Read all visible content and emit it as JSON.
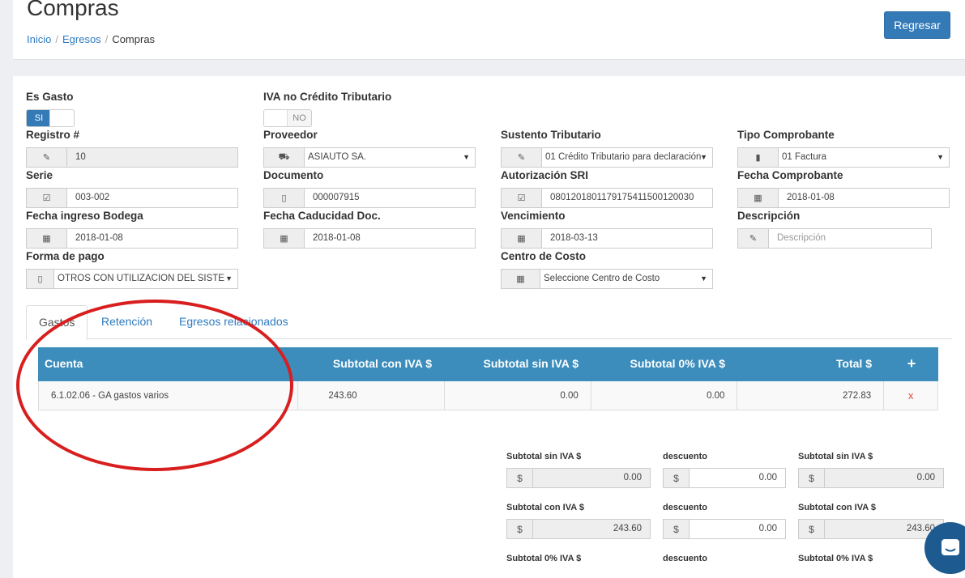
{
  "header": {
    "title": "Compras",
    "breadcrumb": [
      "Inicio",
      "Egresos",
      "Compras"
    ],
    "back_button": "Regresar"
  },
  "form": {
    "es_gasto": {
      "label": "Es Gasto",
      "value": "SI"
    },
    "iva_no_credito": {
      "label": "IVA no Crédito Tributario",
      "value": "NO"
    },
    "registro": {
      "label": "Registro #",
      "value": "10",
      "icon": "pencil-icon"
    },
    "proveedor": {
      "label": "Proveedor",
      "value": "ASIAUTO SA.",
      "icon": "truck-icon"
    },
    "sustento": {
      "label": "Sustento Tributario",
      "value": "01 Crédito Tributario para declaración",
      "icon": "edit-icon"
    },
    "tipo_comprobante": {
      "label": "Tipo Comprobante",
      "value": "01 Factura",
      "icon": "file-icon"
    },
    "serie": {
      "label": "Serie",
      "value": "003-002",
      "icon": "checkbox-icon"
    },
    "documento": {
      "label": "Documento",
      "value": "000007915",
      "icon": "document-icon"
    },
    "autorizacion": {
      "label": "Autorización SRI",
      "value": "0801201801179175411500120030",
      "icon": "check-square-icon"
    },
    "fecha_comprobante": {
      "label": "Fecha Comprobante",
      "value": "2018-01-08",
      "icon": "calendar-icon"
    },
    "fecha_bodega": {
      "label": "Fecha ingreso Bodega",
      "value": "2018-01-08",
      "icon": "calendar-icon"
    },
    "fecha_caducidad": {
      "label": "Fecha Caducidad Doc.",
      "value": "2018-01-08",
      "icon": "calendar-icon"
    },
    "vencimiento": {
      "label": "Vencimiento",
      "value": "2018-03-13",
      "icon": "calendar-icon"
    },
    "descripcion": {
      "label": "Descripción",
      "placeholder": "Descripción",
      "icon": "edit-icon"
    },
    "forma_pago": {
      "label": "Forma de pago",
      "value": "OTROS CON UTILIZACION DEL SISTE",
      "icon": "mobile-icon"
    },
    "centro_costo": {
      "label": "Centro de Costo",
      "value": "Seleccione Centro de Costo",
      "icon": "calendar-icon"
    }
  },
  "tabs": [
    "Gastos",
    "Retención",
    "Egresos relacionados"
  ],
  "grid": {
    "headers": [
      "Cuenta",
      "Subtotal con IVA $",
      "Subtotal sin IVA $",
      "Subtotal 0% IVA $",
      "Total $",
      "+"
    ],
    "rows": [
      {
        "cuenta": "6.1.02.06 - GA gastos varios",
        "con_iva": "243.60",
        "sin_iva": "0.00",
        "cero_iva": "0.00",
        "total": "272.83",
        "action": "x"
      }
    ]
  },
  "totals": {
    "currency": "$",
    "row1": {
      "left_label": "Subtotal sin IVA $",
      "left_value": "0.00",
      "mid_label": "descuento",
      "mid_value": "0.00",
      "right_label": "Subtotal sin IVA $",
      "right_value": "0.00"
    },
    "row2": {
      "left_label": "Subtotal con IVA $",
      "left_value": "243.60",
      "mid_label": "descuento",
      "mid_value": "0.00",
      "right_label": "Subtotal con IVA $",
      "right_value": "243.60"
    },
    "row3": {
      "left_label": "Subtotal 0% IVA $",
      "mid_label": "descuento",
      "right_label": "Subtotal 0% IVA $"
    }
  },
  "colors": {
    "primary": "#337ab7",
    "header_bg": "#3c8dbc",
    "danger": "#dd4b39",
    "annotation": "#d81e1e"
  }
}
